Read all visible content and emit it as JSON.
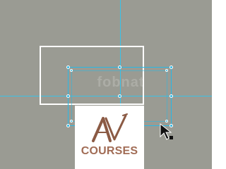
{
  "colors": {
    "canvas_bg": "#9a9b93",
    "guide": "#39c2e8",
    "frame": "#ffffff",
    "selection": "#27b8e6",
    "handle": "#2fb6e2",
    "logo_brown": "#8b5a44",
    "logo_text": "#a16c55",
    "cursor": "#111111"
  },
  "watermark": {
    "text": "fobnat"
  },
  "logo": {
    "monogram": "AV",
    "text": "COURSES"
  },
  "icons": {
    "cursor": "arrow-pointer-icon"
  }
}
